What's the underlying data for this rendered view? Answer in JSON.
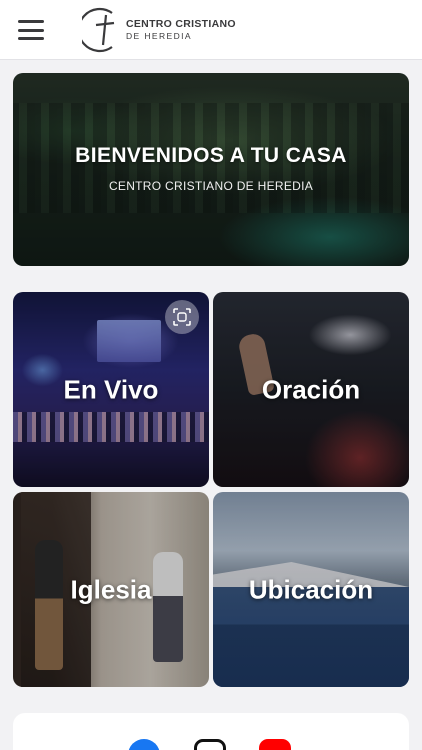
{
  "header": {
    "menu_icon": "hamburger-menu-icon",
    "logo": {
      "line1": "CENTRO CRISTIANO",
      "line2": "DE HEREDIA"
    }
  },
  "hero": {
    "title": "BIENVENIDOS A TU CASA",
    "subtitle": "CENTRO CRISTIANO DE HEREDIA"
  },
  "tiles": [
    {
      "label": "En Vivo",
      "icon": "scan-icon"
    },
    {
      "label": "Oración"
    },
    {
      "label": "Iglesia"
    },
    {
      "label": "Ubicación"
    }
  ],
  "social": [
    {
      "name": "facebook-icon",
      "color": "#1877f2"
    },
    {
      "name": "instagram-icon",
      "color": "#111111"
    },
    {
      "name": "youtube-icon",
      "color": "#ff0000"
    }
  ],
  "colors": {
    "background": "#f2f2f4",
    "header": "#ffffff",
    "logo_text": "#3a3a3c"
  }
}
